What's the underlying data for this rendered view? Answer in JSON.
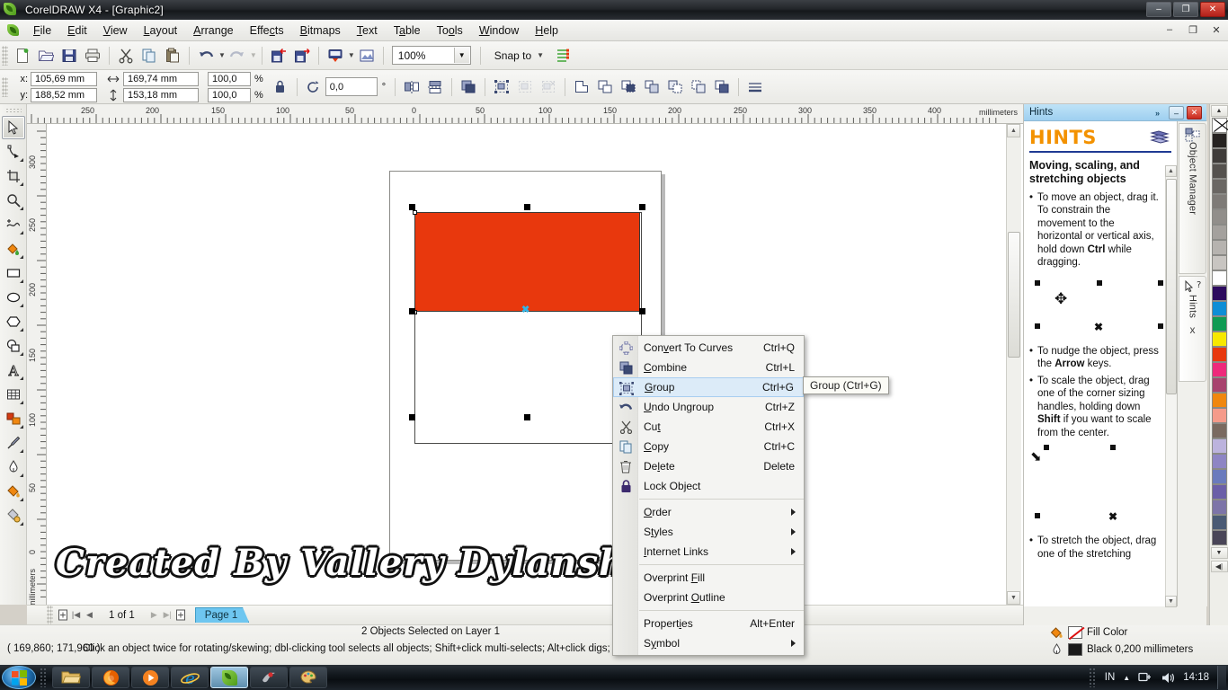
{
  "window": {
    "title": "CorelDRAW X4 - [Graphic2]",
    "app_icon": "coreldraw-leaf-icon",
    "buttons": {
      "minimize": "–",
      "maximize": "❐",
      "close": "✕"
    },
    "doc_buttons": {
      "minimize": "–",
      "restore": "❐",
      "close": "✕"
    }
  },
  "menubar": {
    "items": [
      {
        "label": "File",
        "accel": "F"
      },
      {
        "label": "Edit",
        "accel": "E"
      },
      {
        "label": "View",
        "accel": "V"
      },
      {
        "label": "Layout",
        "accel": "L"
      },
      {
        "label": "Arrange",
        "accel": "A"
      },
      {
        "label": "Effects",
        "accel": "c"
      },
      {
        "label": "Bitmaps",
        "accel": "B"
      },
      {
        "label": "Text",
        "accel": "T"
      },
      {
        "label": "Table",
        "accel": "a"
      },
      {
        "label": "Tools",
        "accel": "o"
      },
      {
        "label": "Window",
        "accel": "W"
      },
      {
        "label": "Help",
        "accel": "H"
      }
    ]
  },
  "toolbar": {
    "buttons": [
      "new-document-icon",
      "open-document-icon",
      "save-icon",
      "print-icon",
      "cut-icon",
      "copy-icon",
      "paste-icon",
      "undo-icon",
      "redo-icon",
      "import-icon",
      "export-icon",
      "application-launcher-icon",
      "corel-connect-icon"
    ],
    "zoom_level": "100%",
    "snap_to_label": "Snap to",
    "options_icon": "options-icon"
  },
  "propertybar": {
    "x_label": "x:",
    "y_label": "y:",
    "x_value": "105,69 mm",
    "y_value": "188,52 mm",
    "width_value": "169,74 mm",
    "height_value": "153,18 mm",
    "scale_h": "100,0",
    "scale_v": "100,0",
    "percent": "%",
    "lock_icon": "lock-ratio-icon",
    "rotation_value": "0,0",
    "degree_symbol": "°",
    "width_icon": "object-width-icon",
    "height_icon": "object-height-icon",
    "rotate_icon": "rotation-angle-icon",
    "buttons": [
      "mirror-horizontal-icon",
      "mirror-vertical-icon",
      "to-front-icon",
      "group-icon",
      "ungroup-icon",
      "ungroup-all-icon",
      "weld-icon",
      "trim-icon",
      "intersect-icon",
      "simplify-icon",
      "front-minus-back-icon",
      "back-minus-front-icon",
      "boundary-icon",
      "outline-width-icon"
    ]
  },
  "toolbox": {
    "tools": [
      {
        "name": "pick-tool",
        "icon": "arrow-cursor-icon",
        "active": true
      },
      {
        "name": "shape-tool",
        "icon": "node-edit-icon",
        "active": false
      },
      {
        "name": "crop-tool",
        "icon": "crop-icon",
        "active": false
      },
      {
        "name": "zoom-tool",
        "icon": "magnifier-icon",
        "active": false
      },
      {
        "name": "freehand-tool",
        "icon": "freehand-curve-icon",
        "active": false
      },
      {
        "name": "smart-fill-tool",
        "icon": "smart-fill-icon",
        "active": false
      },
      {
        "name": "rectangle-tool",
        "icon": "rectangle-icon",
        "active": false
      },
      {
        "name": "ellipse-tool",
        "icon": "ellipse-icon",
        "active": false
      },
      {
        "name": "polygon-tool",
        "icon": "polygon-icon",
        "active": false
      },
      {
        "name": "basic-shapes-tool",
        "icon": "basic-shapes-icon",
        "active": false
      },
      {
        "name": "text-tool",
        "icon": "letter-a-icon",
        "active": false
      },
      {
        "name": "table-tool",
        "icon": "table-grid-icon",
        "active": false
      },
      {
        "name": "blend-tool",
        "icon": "interactive-blend-icon",
        "active": false
      },
      {
        "name": "eyedropper-tool",
        "icon": "eyedropper-icon",
        "active": false
      },
      {
        "name": "outline-tool",
        "icon": "outline-pen-icon",
        "active": false
      },
      {
        "name": "fill-tool",
        "icon": "fill-bucket-icon",
        "active": false
      },
      {
        "name": "interactive-fill-tool",
        "icon": "interactive-fill-icon",
        "active": false
      }
    ]
  },
  "rulers": {
    "unit": "millimeters",
    "horizontal_ticks": [
      "250",
      "200",
      "150",
      "100",
      "50",
      "0",
      "50",
      "100",
      "150",
      "200",
      "250",
      "300",
      "350",
      "400"
    ],
    "vertical_ticks": [
      "300",
      "250",
      "200",
      "150",
      "100",
      "50",
      "0"
    ]
  },
  "canvas": {
    "watermark": "Created By Vallery Dylansha",
    "shape_fill": "#e8380d",
    "shape_outline": "#3a3a38"
  },
  "pagebar": {
    "page_indicator": "1 of 1",
    "page_tab": "Page 1",
    "first_icon": "first-page-icon",
    "prev_icon": "previous-page-icon",
    "next_icon": "next-page-icon",
    "last_icon": "last-page-icon",
    "add_page_left_icon": "add-page-before-icon",
    "add_page_right_icon": "add-page-after-icon"
  },
  "statusbar": {
    "objects_selected": "2 Objects Selected on Layer 1",
    "coordinates": "( 169,860; 171,960 )",
    "hint_text": "Click an object twice for rotating/skewing; dbl-clicking tool selects all objects; Shift+click multi-selects; Alt+click digs; (",
    "fill_label": "Fill Color",
    "fill_swatch": "none",
    "outline_label": "Black  0,200 millimeters",
    "outline_swatch": "#1a1a1a",
    "fill_icon": "fill-bucket-icon",
    "outline_icon": "outline-pen-icon"
  },
  "docker": {
    "title": "Hints",
    "expand_icon": "»",
    "minimize_icon": "–",
    "close_icon": "✕",
    "heading": "HINTS",
    "book_icon": "book-icon",
    "section_title": "Moving, scaling, and stretching objects",
    "hints": [
      {
        "lead": "To move an object, drag it. To constrain the movement to the horizontal or vertical axis, hold down ",
        "bold": "Ctrl",
        "tail": " while dragging.",
        "figure": "move-cursor-figure"
      },
      {
        "lead": "To nudge the object, press the ",
        "bold": "Arrow",
        "tail": " keys.",
        "figure": ""
      },
      {
        "lead": "To scale the object, drag one of the corner sizing handles, holding down ",
        "bold": "Shift",
        "tail": " if you want to scale from the center.",
        "figure": "scale-cursor-figure"
      },
      {
        "lead": "To stretch the object, drag one of the stretching",
        "bold": "",
        "tail": "",
        "figure": ""
      }
    ],
    "tabs": [
      {
        "label": "Object Manager",
        "icon": "object-manager-icon"
      },
      {
        "label": "Hints",
        "icon": "hints-pointer-icon"
      }
    ],
    "tab_close": "x"
  },
  "palette": {
    "up_arrow": "▲",
    "down_arrow": "▼",
    "expand_icon": "◀|",
    "swatches": [
      "none",
      "#262321",
      "#3f3c39",
      "#55524e",
      "#6a6763",
      "#7e7b77",
      "#918e8a",
      "#a4a19d",
      "#b6b3af",
      "#c8c5c1",
      "#ffffff",
      "#2d0b5e",
      "#0d8ed6",
      "#0f9b53",
      "#f7e800",
      "#e8380d",
      "#ee2a7b",
      "#a8436e",
      "#f0870f",
      "#f59b8a",
      "#7a6a60",
      "#bcb3dd",
      "#8e85c4",
      "#6a7bbd",
      "#6b5fa8",
      "#7d74a8",
      "#4a5a74",
      "#4a4658"
    ]
  },
  "context_menu": {
    "items": [
      {
        "label": "Convert To Curves",
        "accel": "v",
        "shortcut": "Ctrl+Q",
        "icon": "convert-to-curves-icon",
        "submenu": false,
        "highlight": false
      },
      {
        "label": "Combine",
        "accel": "C",
        "shortcut": "Ctrl+L",
        "icon": "combine-icon",
        "submenu": false,
        "highlight": false
      },
      {
        "label": "Group",
        "accel": "G",
        "shortcut": "Ctrl+G",
        "icon": "group-icon",
        "submenu": false,
        "highlight": true
      },
      {
        "label": "Undo Ungroup",
        "accel": "U",
        "shortcut": "Ctrl+Z",
        "icon": "undo-icon",
        "submenu": false,
        "highlight": false
      },
      {
        "label": "Cut",
        "accel": "t",
        "shortcut": "Ctrl+X",
        "icon": "scissors-icon",
        "submenu": false,
        "highlight": false
      },
      {
        "label": "Copy",
        "accel": "C",
        "shortcut": "Ctrl+C",
        "icon": "copy-icon",
        "submenu": false,
        "highlight": false
      },
      {
        "label": "Delete",
        "accel": "l",
        "shortcut": "Delete",
        "icon": "trash-icon",
        "submenu": false,
        "highlight": false
      },
      {
        "label": "Lock Object",
        "accel": "",
        "shortcut": "",
        "icon": "lock-icon",
        "submenu": false,
        "highlight": false
      },
      {
        "separator": true
      },
      {
        "label": "Order",
        "accel": "O",
        "shortcut": "",
        "icon": "",
        "submenu": true,
        "highlight": false
      },
      {
        "label": "Styles",
        "accel": "t",
        "shortcut": "",
        "icon": "",
        "submenu": true,
        "highlight": false
      },
      {
        "label": "Internet Links",
        "accel": "I",
        "shortcut": "",
        "icon": "",
        "submenu": true,
        "highlight": false
      },
      {
        "separator": true
      },
      {
        "label": "Overprint Fill",
        "accel": "F",
        "shortcut": "",
        "icon": "",
        "submenu": false,
        "highlight": false
      },
      {
        "label": "Overprint Outline",
        "accel": "O",
        "shortcut": "",
        "icon": "",
        "submenu": false,
        "highlight": false
      },
      {
        "separator": true
      },
      {
        "label": "Properties",
        "accel": "i",
        "shortcut": "Alt+Enter",
        "icon": "",
        "submenu": false,
        "highlight": false
      },
      {
        "label": "Symbol",
        "accel": "y",
        "shortcut": "",
        "icon": "",
        "submenu": true,
        "highlight": false
      }
    ],
    "tooltip": "Group (Ctrl+G)"
  },
  "taskbar": {
    "start_icon": "windows-start-orb",
    "apps": [
      {
        "name": "windows-explorer",
        "icon": "folder-icon",
        "active": false
      },
      {
        "name": "mozilla-firefox",
        "icon": "firefox-icon",
        "active": false
      },
      {
        "name": "media-player",
        "icon": "play-circle-icon",
        "active": false
      },
      {
        "name": "internet-explorer",
        "icon": "ie-e-icon",
        "active": false
      },
      {
        "name": "coreldraw",
        "icon": "coreldraw-leaf-icon",
        "active": true
      },
      {
        "name": "corel-photo-paint",
        "icon": "photopaint-icon",
        "active": false
      },
      {
        "name": "paint-app",
        "icon": "palette-icon",
        "active": false
      }
    ],
    "tray": {
      "language": "IN",
      "show_hidden": "▲",
      "network_icon": "network-plug-icon",
      "volume_icon": "speaker-icon",
      "clock": "14:18"
    }
  }
}
